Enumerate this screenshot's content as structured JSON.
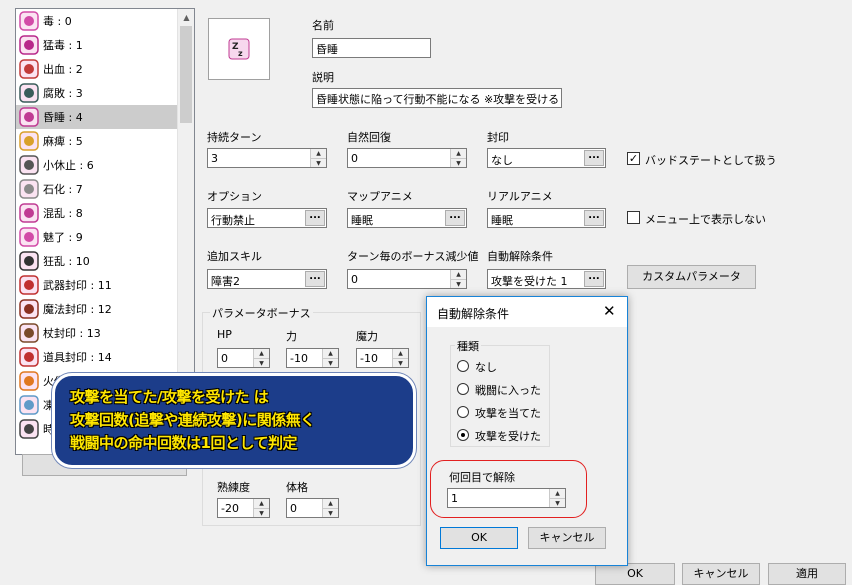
{
  "states": [
    {
      "label": "毒 : 0",
      "icon": "poison-icon"
    },
    {
      "label": "猛毒 : 1",
      "icon": "deadly-poison-icon"
    },
    {
      "label": "出血 : 2",
      "icon": "bleeding-icon"
    },
    {
      "label": "腐敗 : 3",
      "icon": "rot-icon"
    },
    {
      "label": "昏睡 : 4",
      "icon": "sleep-icon"
    },
    {
      "label": "麻痺 : 5",
      "icon": "paralysis-icon"
    },
    {
      "label": "小休止 : 6",
      "icon": "rest-icon"
    },
    {
      "label": "石化 : 7",
      "icon": "petrify-icon"
    },
    {
      "label": "混乱 : 8",
      "icon": "confusion-icon"
    },
    {
      "label": "魅了 : 9",
      "icon": "charm-icon"
    },
    {
      "label": "狂乱 : 10",
      "icon": "berserk-icon"
    },
    {
      "label": "武器封印 : 11",
      "icon": "weapon-seal-icon"
    },
    {
      "label": "魔法封印 : 12",
      "icon": "magic-seal-icon"
    },
    {
      "label": "杖封印 : 13",
      "icon": "staff-seal-icon"
    },
    {
      "label": "道具封印 : 14",
      "icon": "item-seal-icon"
    },
    {
      "label": "火傷",
      "icon": "burn-icon"
    },
    {
      "label": "凍",
      "icon": "freeze-icon"
    },
    {
      "label": "時",
      "icon": "time-icon"
    }
  ],
  "selected_index": 4,
  "form": {
    "name_label": "名前",
    "name_value": "昏睡",
    "desc_label": "説明",
    "desc_value": "昏睡状態に陥って行動不能になる ※攻撃を受けると",
    "duration_label": "持続ターン",
    "duration_value": "3",
    "recovery_label": "自然回復",
    "recovery_value": "0",
    "seal_label": "封印",
    "seal_value": "なし",
    "bad_status_label": "バッドステートとして扱う",
    "bad_status_checked": true,
    "option_label": "オプション",
    "option_value": "行動禁止",
    "map_anim_label": "マップアニメ",
    "map_anim_value": "睡眠",
    "real_anim_label": "リアルアニメ",
    "real_anim_value": "睡眠",
    "hide_menu_label": "メニュー上で表示しない",
    "hide_menu_checked": false,
    "add_skill_label": "追加スキル",
    "add_skill_value": "障害2",
    "bonus_decay_label": "ターン毎のボーナス減少値",
    "bonus_decay_value": "0",
    "auto_release_label": "自動解除条件",
    "auto_release_value": "攻撃を受けた 1",
    "custom_param_label": "カスタムパラメータ",
    "param_group_label": "パラメータボーナス",
    "params": [
      {
        "label": "HP",
        "value": "0"
      },
      {
        "label": "力",
        "value": "-10"
      },
      {
        "label": "魔力",
        "value": "-10"
      }
    ],
    "params_bottom": [
      {
        "label": "熟練度",
        "value": "-20"
      },
      {
        "label": "体格",
        "value": "0"
      }
    ],
    "ellipsis": "...",
    "ok_label": "OK",
    "cancel_label": "キャンセル",
    "apply_label": "適用"
  },
  "dialog": {
    "title": "自動解除条件",
    "type_group_label": "種類",
    "options": [
      "なし",
      "戦闘に入った",
      "攻撃を当てた",
      "攻撃を受けた"
    ],
    "selected_option": 3,
    "count_label": "何回目で解除",
    "count_value": "1",
    "ok_label": "OK",
    "cancel_label": "キャンセル"
  },
  "callout": {
    "line1": "攻撃を当てた/攻撃を受けた は",
    "line2": "攻撃回数(追撃や連続攻撃)に関係無く",
    "line3": "戦闘中の命中回数は1回として判定"
  },
  "colors": {
    "callout_bg": "#1c3d8a",
    "callout_text": "#ffe600",
    "highlight_ring": "#e22020",
    "dialog_border": "#1883d7"
  }
}
